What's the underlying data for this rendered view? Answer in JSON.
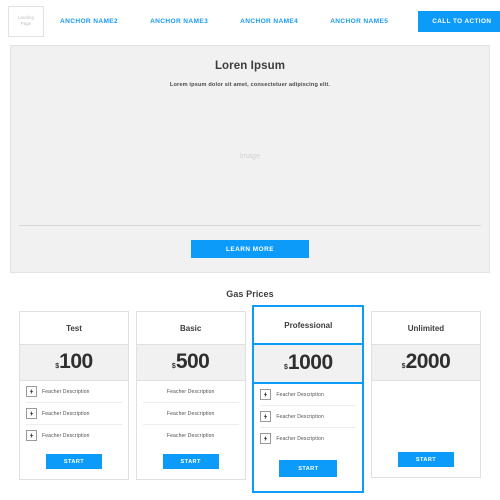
{
  "theme": {
    "accent": "#0d9bf9",
    "nav_link_color": "#1a9bf5",
    "hero_bg": "#f1f1f1",
    "price_band_bg": "#f1f1f1",
    "card_border": "#e0e0e0",
    "text_color": "#3d3d3d",
    "muted_color": "#cfcfcf"
  },
  "header": {
    "logo": {
      "line1": "Landing",
      "line2": "Page",
      "icon": "logo-placeholder-box"
    },
    "nav_items": [
      {
        "label": "ANCHOR NAME2"
      },
      {
        "label": "ANCHOR NAME3"
      },
      {
        "label": "ANCHOR NAME4"
      },
      {
        "label": "ANCHOR NAME5"
      }
    ],
    "cta_label": "CALL TO ACTION"
  },
  "hero": {
    "title": "Loren Ipsum",
    "subtitle": "Lorem ipsum dolor sit amet, consectetuer adipiscing elit.",
    "image_placeholder": "Image",
    "button_label": "LEARN MORE"
  },
  "pricing": {
    "section_title": "Gas Prices",
    "currency_symbol": "$",
    "start_label": "START",
    "feature_icon": "lightning-bolt-icon",
    "plans": [
      {
        "name": "Test",
        "price": "100",
        "featured": false,
        "features": [
          {
            "label": "Feacher Description",
            "has_icon": true
          },
          {
            "label": "Feacher Description",
            "has_icon": true
          },
          {
            "label": "Feacher Description",
            "has_icon": true
          }
        ]
      },
      {
        "name": "Basic",
        "price": "500",
        "featured": false,
        "features": [
          {
            "label": "Feacher Description",
            "has_icon": false
          },
          {
            "label": "Feacher Description",
            "has_icon": false
          },
          {
            "label": "Feacher Description",
            "has_icon": false
          }
        ]
      },
      {
        "name": "Professional",
        "price": "1000",
        "featured": true,
        "features": [
          {
            "label": "Feacher Description",
            "has_icon": true
          },
          {
            "label": "Feacher Description",
            "has_icon": true
          },
          {
            "label": "Feacher Description",
            "has_icon": true
          }
        ]
      },
      {
        "name": "Unlimited",
        "price": "2000",
        "featured": false,
        "features": []
      }
    ]
  }
}
